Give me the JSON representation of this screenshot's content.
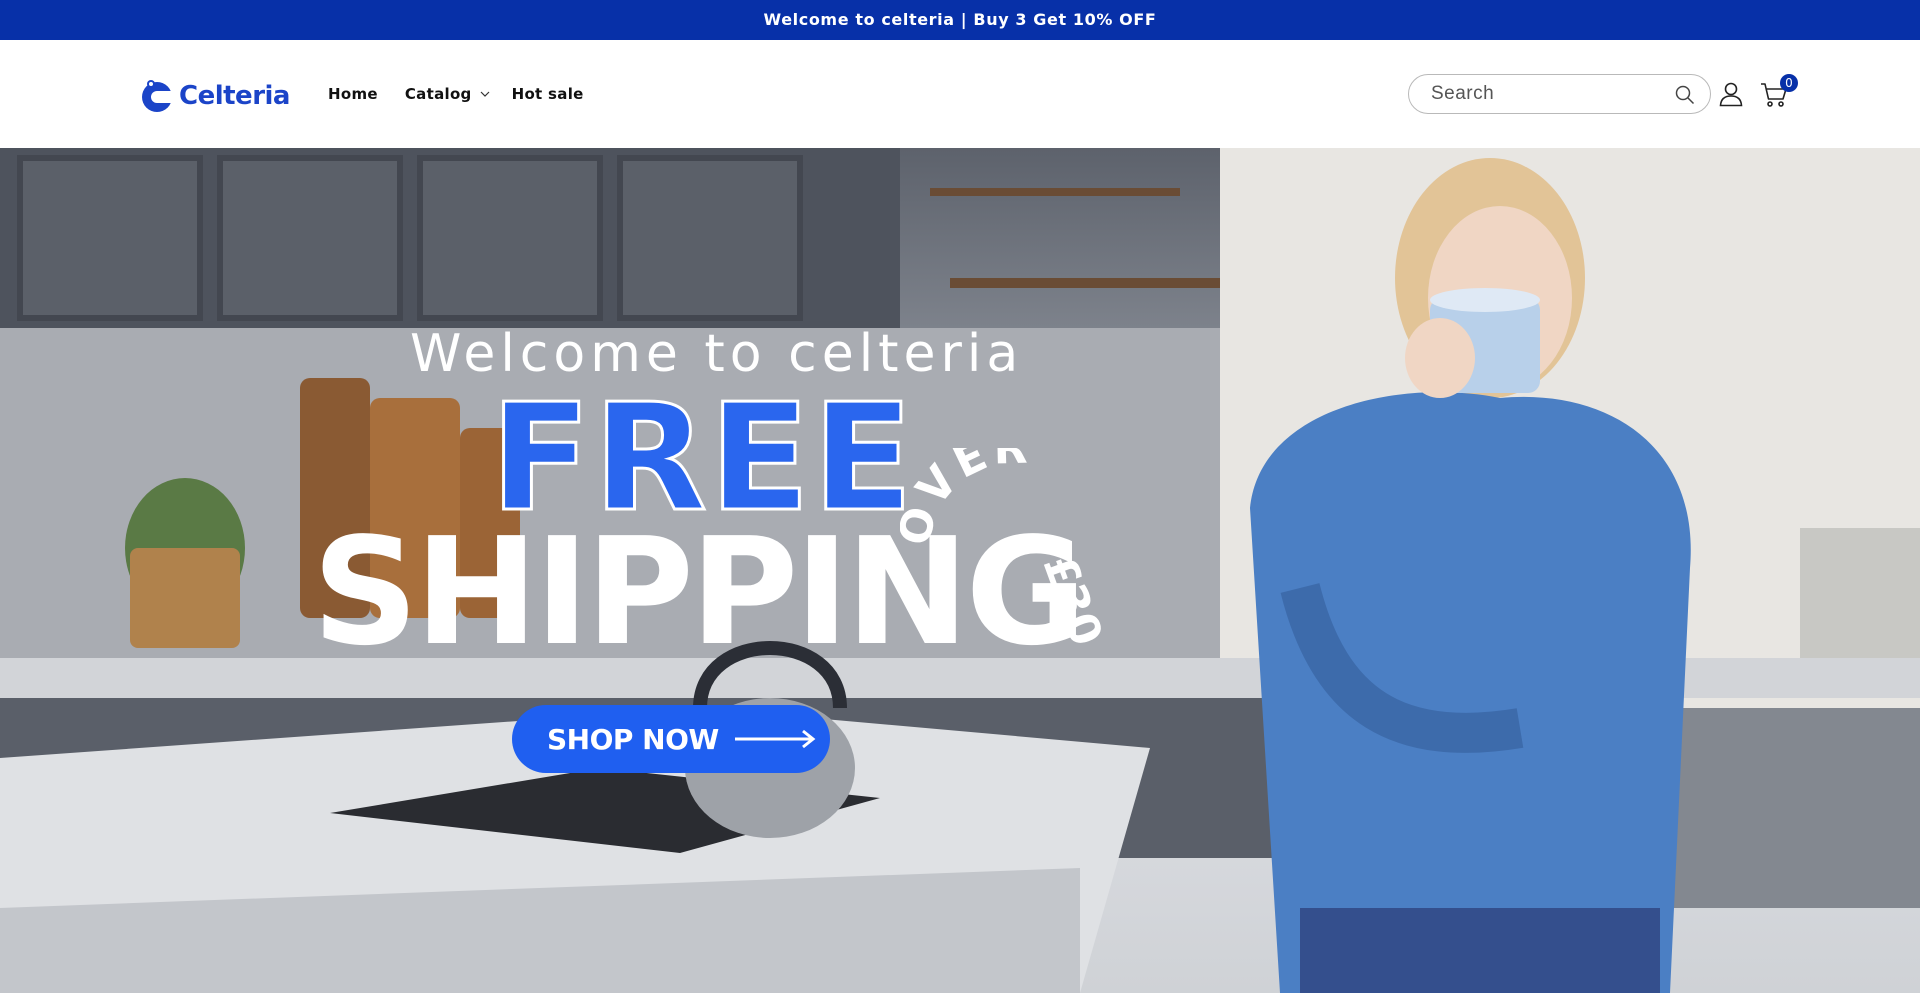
{
  "announcement": {
    "text": "Welcome to celteria | Buy 3 Get 10% OFF"
  },
  "header": {
    "logo_text": "Celteria",
    "nav": [
      {
        "label": "Home"
      },
      {
        "label": "Catalog"
      },
      {
        "label": "Hot sale"
      }
    ],
    "search": {
      "placeholder": "Search",
      "value": ""
    },
    "cart_count": "0",
    "icons": [
      "search-icon",
      "account-icon",
      "cart-icon",
      "chevron-down-icon"
    ]
  },
  "hero": {
    "welcome": "Welcome to celteria",
    "free": "FREE",
    "shipping": "SHIPPING",
    "over": "OVER",
    "amount": "£30",
    "button_label": "SHOP NOW"
  },
  "colors": {
    "announcement_bg": "#0730a8",
    "brand_blue": "#1b44c8",
    "button_blue": "#1f5ff0",
    "free_blue": "#2a66ee"
  }
}
